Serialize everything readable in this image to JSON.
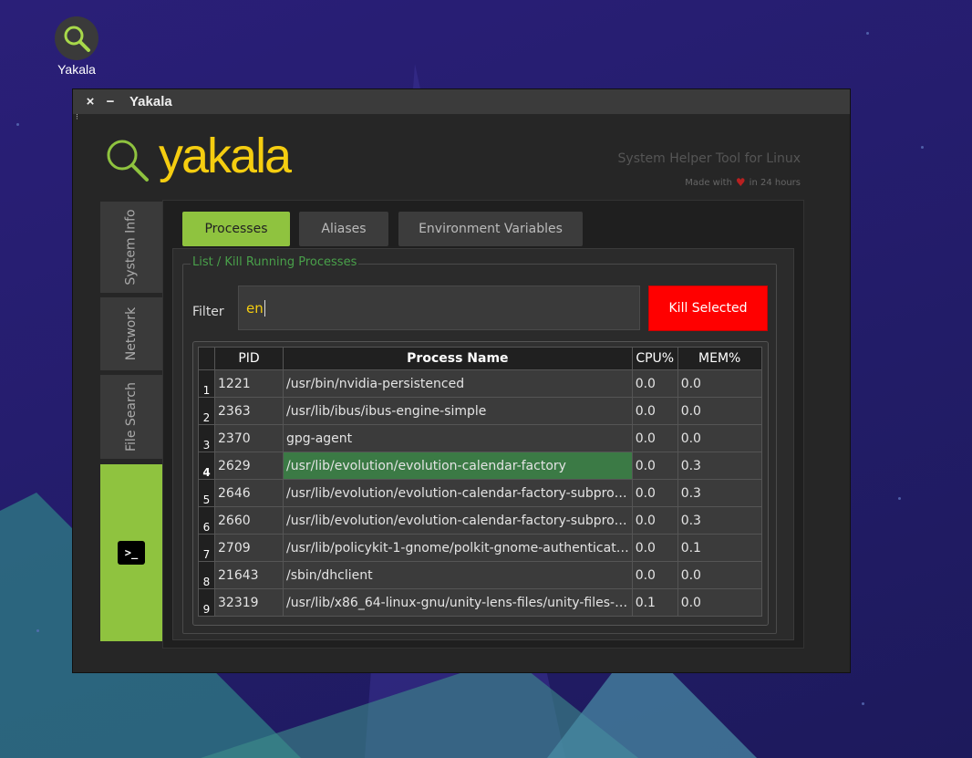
{
  "desktop": {
    "icon_label": "Yakala"
  },
  "window": {
    "title": "Yakala",
    "close_glyph": "×",
    "minimize_glyph": "−",
    "grip_glyph": "⁝"
  },
  "header": {
    "logo_text": "yakala",
    "tagline": "System Helper Tool for Linux",
    "made_with": "Made with",
    "made_in": "in 24 hours"
  },
  "sidebar": {
    "items": [
      {
        "label": "System Info"
      },
      {
        "label": "Network"
      },
      {
        "label": "File Search"
      },
      {
        "label": ">_"
      }
    ]
  },
  "tabs": [
    {
      "label": "Processes"
    },
    {
      "label": "Aliases"
    },
    {
      "label": "Environment Variables"
    }
  ],
  "processes": {
    "group_title": "List / Kill Running Processes",
    "filter_label": "Filter",
    "filter_value": "en",
    "kill_label": "Kill Selected",
    "columns": [
      "PID",
      "Process Name",
      "CPU%",
      "MEM%"
    ],
    "rows": [
      {
        "n": "1",
        "pid": "1221",
        "name": "/usr/bin/nvidia-persistenced",
        "cpu": "0.0",
        "mem": "0.0"
      },
      {
        "n": "2",
        "pid": "2363",
        "name": "/usr/lib/ibus/ibus-engine-simple",
        "cpu": "0.0",
        "mem": "0.0"
      },
      {
        "n": "3",
        "pid": "2370",
        "name": "gpg-agent",
        "cpu": "0.0",
        "mem": "0.0"
      },
      {
        "n": "4",
        "pid": "2629",
        "name": "/usr/lib/evolution/evolution-calendar-factory",
        "cpu": "0.0",
        "mem": "0.3"
      },
      {
        "n": "5",
        "pid": "2646",
        "name": "/usr/lib/evolution/evolution-calendar-factory-subpro…",
        "cpu": "0.0",
        "mem": "0.3"
      },
      {
        "n": "6",
        "pid": "2660",
        "name": "/usr/lib/evolution/evolution-calendar-factory-subpro…",
        "cpu": "0.0",
        "mem": "0.3"
      },
      {
        "n": "7",
        "pid": "2709",
        "name": "/usr/lib/policykit-1-gnome/polkit-gnome-authenticat…",
        "cpu": "0.0",
        "mem": "0.1"
      },
      {
        "n": "8",
        "pid": "21643",
        "name": "/sbin/dhclient",
        "cpu": "0.0",
        "mem": "0.0"
      },
      {
        "n": "9",
        "pid": "32319",
        "name": "/usr/lib/x86_64-linux-gnu/unity-lens-files/unity-files-…",
        "cpu": "0.1",
        "mem": "0.0"
      }
    ]
  },
  "colors": {
    "accent": "#8fc33f",
    "logo": "#f5cd10",
    "kill": "#ff0000",
    "selected_row": "#3b7a45"
  }
}
